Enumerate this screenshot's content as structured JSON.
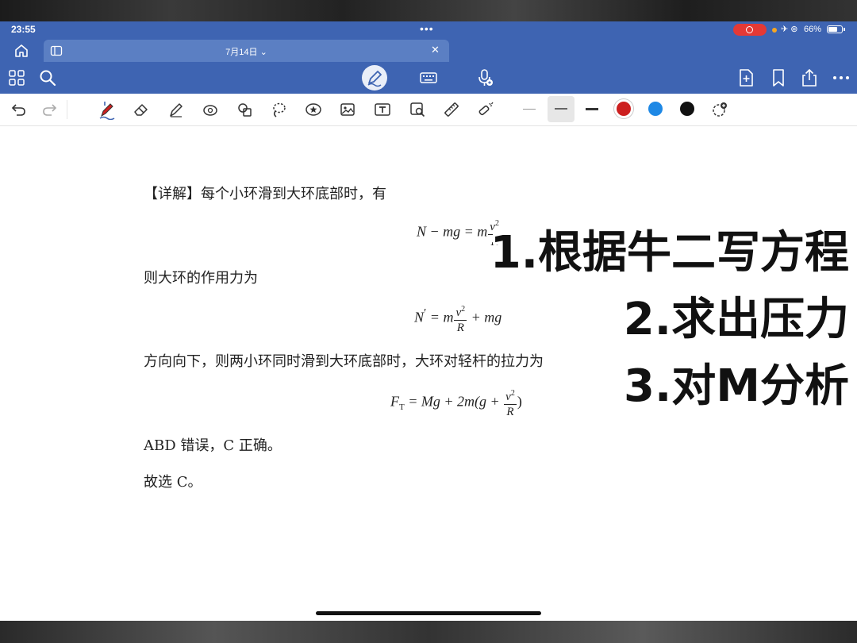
{
  "status_bar": {
    "time": "23:55",
    "battery_percent": "66%",
    "battery_level": 0.66
  },
  "tab": {
    "title": "7月14日 ⌄"
  },
  "colors": {
    "header_blue": "#3e64b2",
    "tab_blue": "#5b7fc3",
    "pen_red": "#cc1f1f",
    "blue_swatch": "#1e88e5",
    "black_swatch": "#111111"
  },
  "toolbar1": {
    "left_icons": [
      "grid-icon",
      "search-icon"
    ],
    "center_icons": [
      "pen-mode-icon",
      "keyboard-icon",
      "microphone-icon"
    ],
    "right_icons": [
      "add-page-icon",
      "bookmark-icon",
      "share-icon",
      "more-icon"
    ]
  },
  "toolbar2": {
    "tools": [
      "undo-icon",
      "redo-icon",
      "pen-icon",
      "eraser-icon",
      "highlighter-icon",
      "shape-icon",
      "lasso-shapes-icon",
      "lasso-icon",
      "sticker-icon",
      "image-icon",
      "text-icon",
      "image-search-icon",
      "ruler-icon",
      "laser-icon"
    ],
    "swatches": [
      "#cc1f1f",
      "#1e88e5",
      "#111111"
    ]
  },
  "document": {
    "line1": "【详解】每个小环滑到大环底部时，有",
    "eq1": {
      "left": "N − mg = m",
      "num": "v",
      "exp": "2",
      "den": "R"
    },
    "line2": "则大环的作用力为",
    "eq2": {
      "left": "N",
      "prime": "′",
      "mid": " = m",
      "num": "v",
      "exp": "2",
      "den": "R",
      "right": " + mg"
    },
    "line3": "方向向下，则两小环同时滑到大环底部时，大环对轻杆的拉力为",
    "eq3": {
      "left": "F",
      "sub": "T",
      "mid": " = Mg + 2m(g + ",
      "num": "v",
      "exp": "2",
      "den": "R",
      "right": ")"
    },
    "line4": "ABD 错误，C 正确。",
    "line5": "故选 C。"
  },
  "overlay_notes": [
    "1.根据牛二写方程",
    "2.求出压力",
    "3.对M分析"
  ]
}
